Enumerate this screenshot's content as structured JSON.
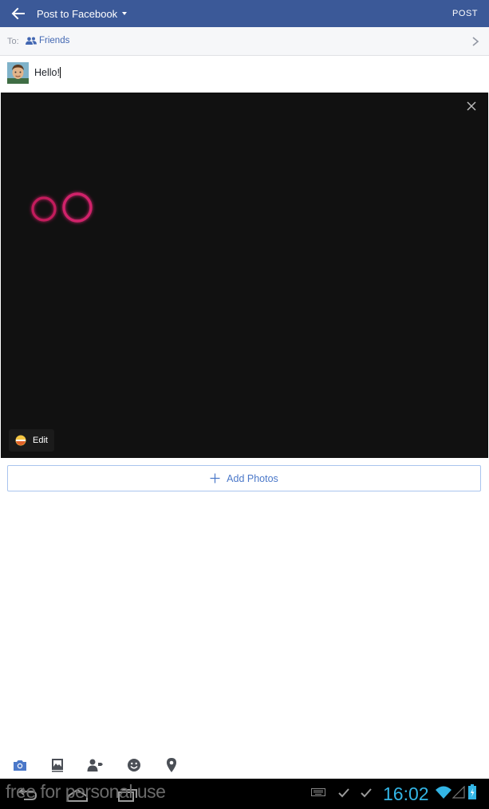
{
  "header": {
    "title": "Post to Facebook",
    "post_label": "POST",
    "bg_color": "#3b5998"
  },
  "audience": {
    "to_label": "To:",
    "value": "Friends",
    "icon": "friends-icon"
  },
  "composer": {
    "text": "Hello!"
  },
  "photo": {
    "edit_label": "Edit",
    "close_icon": "close-icon"
  },
  "add_photos": {
    "label": "Add Photos"
  },
  "toolbar": {
    "icons": [
      "camera-icon",
      "photo-gallery-icon",
      "tag-people-icon",
      "feeling-icon",
      "location-icon"
    ]
  },
  "system": {
    "watermark": "free for personal use",
    "time": "16:02",
    "accent_color": "#33b5e5"
  }
}
